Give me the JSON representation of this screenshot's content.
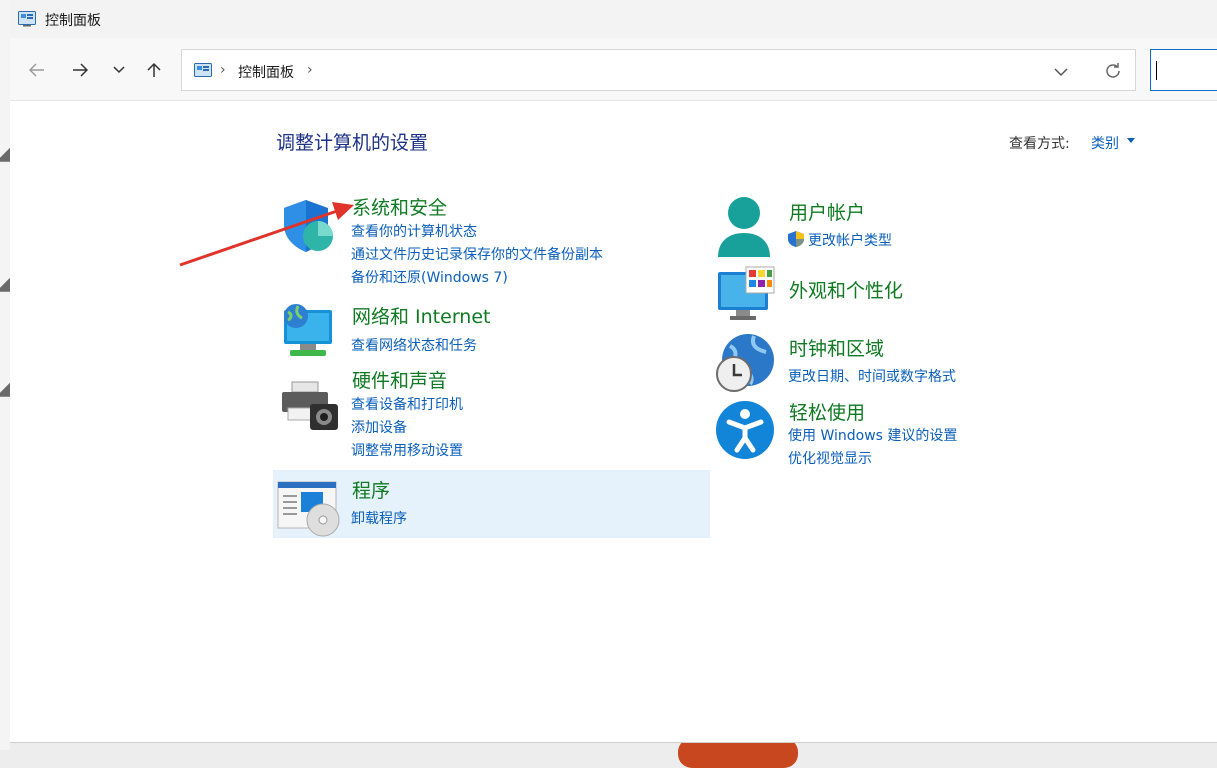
{
  "window": {
    "title": "控制面板"
  },
  "address": {
    "crumb": "控制面板"
  },
  "heading": "调整计算机的设置",
  "view": {
    "label": "查看方式:",
    "value": "类别"
  },
  "categories": {
    "system": {
      "title": "系统和安全",
      "links": [
        "查看你的计算机状态",
        "通过文件历史记录保存你的文件备份副本",
        "备份和还原(Windows 7)"
      ]
    },
    "network": {
      "title": "网络和 Internet",
      "links": [
        "查看网络状态和任务"
      ]
    },
    "hardware": {
      "title": "硬件和声音",
      "links": [
        "查看设备和打印机",
        "添加设备",
        "调整常用移动设置"
      ]
    },
    "programs": {
      "title": "程序",
      "links": [
        "卸载程序"
      ]
    },
    "users": {
      "title": "用户帐户",
      "links": [
        "更改帐户类型"
      ]
    },
    "appearance": {
      "title": "外观和个性化"
    },
    "clock": {
      "title": "时钟和区域",
      "links": [
        "更改日期、时间或数字格式"
      ]
    },
    "ease": {
      "title": "轻松使用",
      "links": [
        "使用 Windows 建议的设置",
        "优化视觉显示"
      ]
    }
  },
  "colors": {
    "link": "#0b5fbb",
    "category": "#0f7a22",
    "heading": "#1e3287",
    "highlight": "#e5f1fb",
    "arrow": "#e0332a"
  },
  "icons": [
    "back-arrow-icon",
    "forward-arrow-icon",
    "recent-dropdown-icon",
    "up-arrow-icon",
    "control-panel-icon",
    "refresh-icon",
    "shield-icon",
    "user-icon",
    "globe-monitor-icon",
    "monitor-palette-icon",
    "printer-camera-icon",
    "globe-clock-icon",
    "accessibility-icon",
    "program-disc-icon",
    "uac-shield-icon"
  ]
}
